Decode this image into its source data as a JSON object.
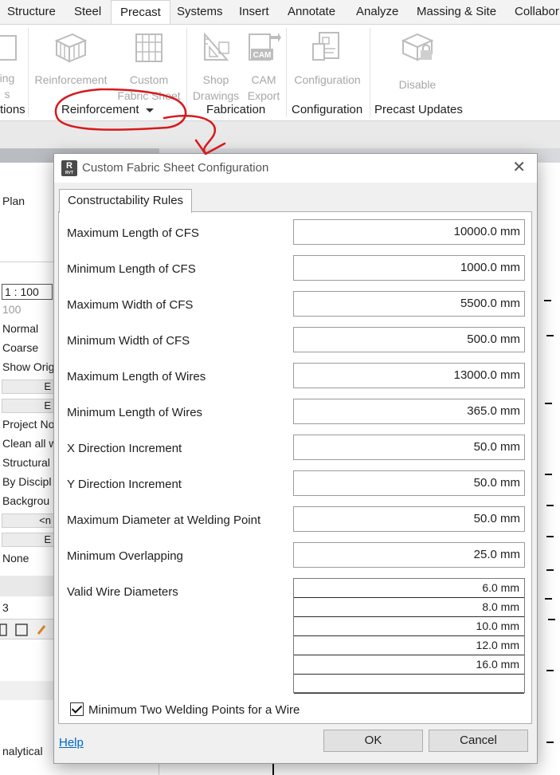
{
  "ribbon": {
    "tabs": [
      "Structure",
      "Steel",
      "Precast",
      "Systems",
      "Insert",
      "Annotate",
      "Analyze",
      "Massing & Site",
      "Collabor"
    ],
    "active_tab": "Precast",
    "buttons": [
      {
        "line1": "ing",
        "line2": "s",
        "icon": "partial-icon"
      },
      {
        "line1": "Reinforcement",
        "line2": "",
        "icon": "reinforcement-icon"
      },
      {
        "line1": "Custom",
        "line2": "Fabric Sheet",
        "icon": "custom-fabric-sheet-icon"
      },
      {
        "line1": "Shop",
        "line2": "Drawings",
        "icon": "shop-drawings-icon"
      },
      {
        "line1": "CAM",
        "line2": "Export",
        "icon": "cam-export-icon"
      },
      {
        "line1": "Configuration",
        "line2": "",
        "icon": "configuration-icon"
      },
      {
        "line1": "Disable",
        "line2": "",
        "icon": "disable-icon"
      }
    ],
    "groups": {
      "g0": "tions",
      "g1": "Reinforcement",
      "g2": "Fabrication",
      "g3": "Configuration",
      "g4": "Precast Updates"
    },
    "cam_badge": "CAM"
  },
  "background": {
    "view_label": "Plan",
    "scale": "1 : 100",
    "scale_value": "100",
    "rows": [
      "Normal",
      "Coarse",
      "Show Origi",
      "",
      "",
      "Project No",
      "Clean all w",
      "Structural",
      "By Discipl",
      "Backgrou",
      "<n",
      "",
      "None"
    ],
    "row_b": "E",
    "lower_label": "3",
    "footer_label": "nalytical"
  },
  "dialog": {
    "app_icon_letter": "R",
    "app_icon_sub": "RVT",
    "title": "Custom Fabric Sheet Configuration",
    "close_glyph": "✕",
    "tab": "Constructability Rules",
    "fields": [
      {
        "label": "Maximum Length of CFS",
        "value": "10000.0 mm"
      },
      {
        "label": "Minimum Length of CFS",
        "value": "1000.0 mm"
      },
      {
        "label": "Maximum Width of CFS",
        "value": "5500.0 mm"
      },
      {
        "label": "Minimum Width of CFS",
        "value": "500.0 mm"
      },
      {
        "label": "Maximum Length of Wires",
        "value": "13000.0 mm"
      },
      {
        "label": "Minimum Length of Wires",
        "value": "365.0 mm"
      },
      {
        "label": "X Direction Increment",
        "value": "50.0 mm"
      },
      {
        "label": "Y Direction Increment",
        "value": "50.0 mm"
      },
      {
        "label": "Maximum Diameter at Welding Point",
        "value": "50.0 mm"
      },
      {
        "label": "Minimum Overlapping",
        "value": "25.0 mm"
      }
    ],
    "wire_label": "Valid Wire Diameters",
    "wire_diameters": [
      "6.0 mm",
      "8.0 mm",
      "10.0 mm",
      "12.0 mm",
      "16.0 mm",
      ""
    ],
    "checkbox_label": "Minimum Two Welding Points for a Wire",
    "checkbox_checked": true,
    "help": "Help",
    "ok": "OK",
    "cancel": "Cancel"
  },
  "colors": {
    "annotation": "#d7191c",
    "link": "#0066cc"
  }
}
